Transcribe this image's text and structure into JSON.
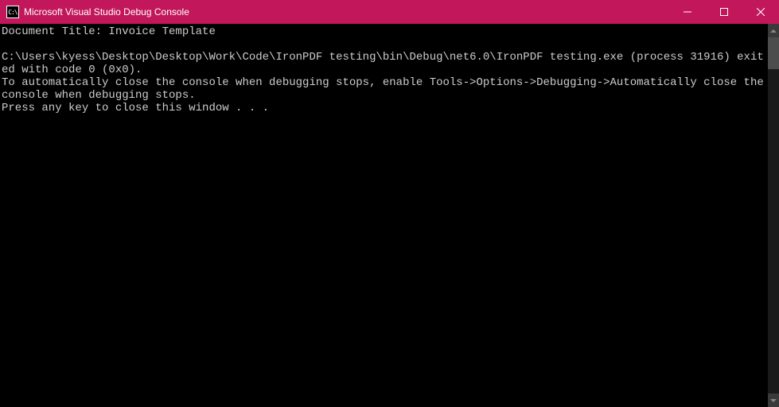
{
  "window": {
    "title": "Microsoft Visual Studio Debug Console",
    "icon_label": "C:\\"
  },
  "console": {
    "lines": [
      "Document Title: Invoice Template",
      "",
      "C:\\Users\\kyess\\Desktop\\Desktop\\Work\\Code\\IronPDF testing\\bin\\Debug\\net6.0\\IronPDF testing.exe (process 31916) exited with code 0 (0x0).",
      "To automatically close the console when debugging stops, enable Tools->Options->Debugging->Automatically close the console when debugging stops.",
      "Press any key to close this window . . ."
    ]
  }
}
